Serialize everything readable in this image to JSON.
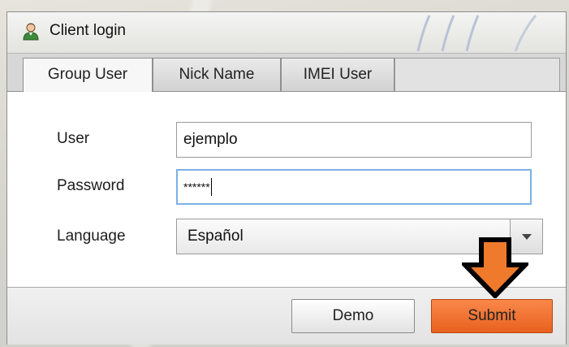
{
  "window": {
    "title": "Client login",
    "title_icon": "user-icon"
  },
  "tabs": [
    {
      "label": "Group User",
      "active": true
    },
    {
      "label": "Nick Name",
      "active": false
    },
    {
      "label": "IMEI User",
      "active": false
    }
  ],
  "form": {
    "user_label": "User",
    "user_value": "ejemplo",
    "password_label": "Password",
    "password_value": "******",
    "language_label": "Language",
    "language_value": "Español"
  },
  "buttons": {
    "demo_label": "Demo",
    "submit_label": "Submit"
  },
  "colors": {
    "submit_accent": "#f07432",
    "focus_border": "#7cb1e5",
    "annotation_arrow": "#f07a2b"
  },
  "annotation": {
    "icon": "down-arrow-icon"
  }
}
